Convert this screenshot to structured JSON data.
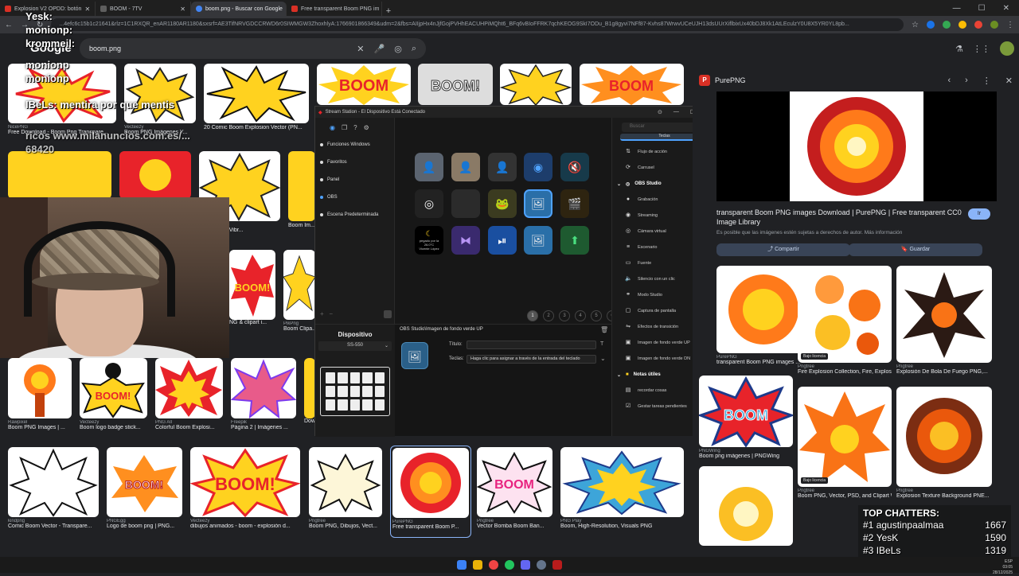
{
  "tabs": [
    {
      "label": "Explosion V2 OPDD: botón",
      "color": "#d93025",
      "active": false
    },
    {
      "label": "BOOM - 7TV",
      "color": "#5e5e5e",
      "active": false
    },
    {
      "label": "boom.png - Buscar con Google",
      "color": "#4285f4",
      "active": true
    },
    {
      "label": "Free transparent Boom PNG im",
      "color": "#d93025",
      "active": false
    }
  ],
  "url": "...4efc6c15b1c21641&rlz=1C1RXQR_enAR1180AR1180&sxsrf=AE3TifNRVGDCCRWD6r0SIWMGW3ZhoxhlyA:1766901866349&udm=2&fbs=AIIjpHx4nJjfGojPVHhEACUHPiMQht6_BFq6vBIoFFRK7qchKEOG9SkI7ODu_B1g8gyvi7NFf87-Kvhs87WrwvUCeUJH13dsUUrXiflbixUx40bDJ8Xk1AtLEculzY0U8X5YR0YL8pb...",
  "google": {
    "logo": "Google",
    "query": "boom.png"
  },
  "chat_overlay": [
    "Yesk:",
    "monionp:",
    "krommeil:",
    "monionp",
    "monionp",
    "IBeLs: mentira por que mentis",
    "ricos www.milanuncios.com.es/...",
    "68420"
  ],
  "grid_row1": [
    {
      "src": "NicePNG",
      "title": "Free Download - Boom Png Transpare..."
    },
    {
      "src": "Vecteezy",
      "title": "Boom PNG Imágenes Y..."
    },
    {
      "src": "",
      "title": "20 Comic Boom Explosion Vector (PN..."
    },
    {
      "src": "",
      "title": ""
    }
  ],
  "grid_row2": [
    {
      "src": "PNG All",
      "title": "c Explosion Vibr..."
    },
    {
      "src": "",
      "title": "Boom Im..."
    }
  ],
  "grid_row3": [
    {
      "src": "",
      "title": "NG & clipart i..."
    },
    {
      "src": "PikPng",
      "title": "Boom Clipa..."
    }
  ],
  "grid_row4": [
    {
      "src": "Rawpixel",
      "title": "Boom PNG Images | ..."
    },
    {
      "src": "Vecteezy",
      "title": "Boom logo badge stick..."
    },
    {
      "src": "PNG All",
      "title": "Colorful Boom Explosi..."
    },
    {
      "src": "Freepik",
      "title": "Página 2 | Imágenes ..."
    },
    {
      "src": "",
      "title": "Dow..."
    }
  ],
  "grid_row5": [
    {
      "src": "kindpng",
      "title": "Comic Boom Vector - Transpare..."
    },
    {
      "src": "PNGEgg",
      "title": "Logo de boom png | PNG..."
    },
    {
      "src": "Vecteezy",
      "title": "dibujos animados - boom - explosión d..."
    },
    {
      "src": "Pngtree",
      "title": "Boom PNG, Dibujos, Vect..."
    },
    {
      "src": "PurePNG",
      "title": "Free transparent Boom P..."
    },
    {
      "src": "Pngtree",
      "title": "Vector Bomba Boom Ban..."
    },
    {
      "src": "PNG Play",
      "title": "Boom, High-Resolution, Visuals PNG"
    }
  ],
  "boom_words": {
    "b1": "BOOM",
    "b2": "BOOM!",
    "b3": "BOOM",
    "b4": "BOOM!",
    "b5": "BOOM!",
    "b6": "BOOM"
  },
  "ss": {
    "title": "Stream Station - El Dispositivo Está Conectado",
    "profiles": [
      "Funciones Windows",
      "Favoritos",
      "Panel",
      "OBS",
      "Escena Predeterminada"
    ],
    "pages": [
      "1",
      "2",
      "3",
      "4",
      "5",
      "6",
      "+"
    ],
    "search_placeholder": "Buscar",
    "tab": "Teclas",
    "group_obs": "OBS Studio",
    "group_notes": "Notas útiles",
    "actions_top": [
      "Flujo de acción",
      "Carrusel"
    ],
    "actions_obs": [
      "Grabación",
      "Streaming",
      "Cámara virtual",
      "Escenario",
      "Fuente",
      "Silencio con un clic",
      "Modo Studio",
      "Captura de pantalla",
      "Efectos de transición",
      "Imagen de fondo verde UP",
      "Imagen de fondo verde DN"
    ],
    "actions_notes": [
      "recordar cosas",
      "Gestar tareas pendientes"
    ],
    "weather_label": "pegado por la",
    "weather_temp": "26.0°C",
    "weather_place": "Vicente López",
    "device_label": "Dispositivo",
    "device_model": "SS-550",
    "cfg_title": "OBS Studio\\Imagen de fondo verde UP",
    "label_titulo": "Título:",
    "label_teclas": "Teclas:",
    "teclas_hint": "Haga clic para asignar a través de la entrada del teclado"
  },
  "panel": {
    "source": "PurePNG",
    "title": "transparent Boom PNG images Download | PurePNG | Free transparent CC0 Image Library",
    "visit": "Ir",
    "note": "Es posible que las imágenes estén sujetas a derechos de autor. Más información",
    "share": "Compartir",
    "save": "Guardar",
    "related": [
      {
        "src": "PurePNG",
        "title": "transparent Boom PNG images ...",
        "badge": ""
      },
      {
        "src": "Pngtree",
        "title": "Fire Explosion Collection, Fire, Explosio...",
        "badge": "Bajo licencia"
      },
      {
        "src": "Pngtree",
        "title": "Explosión De Bola De Fuego PNG,...",
        "badge": ""
      },
      {
        "src": "PNGWing",
        "title": "Boom png imágenes | PNGWing",
        "badge": ""
      },
      {
        "src": "Pngtree",
        "title": "Boom PNG, Vector, PSD, and Clipart Wit...",
        "badge": "Bajo licencia"
      },
      {
        "src": "Pngtree",
        "title": "Explosion Texture Background PNE...",
        "badge": ""
      }
    ]
  },
  "top_chatters": {
    "title": "TOP CHATTERS:",
    "rows": [
      {
        "rank": "#1",
        "name": "agustinpaalmaa",
        "score": "1667"
      },
      {
        "rank": "#2",
        "name": "YesK",
        "score": "1590"
      },
      {
        "rank": "#3",
        "name": "IBeLs",
        "score": "1319"
      }
    ]
  },
  "clock": {
    "lang": "ESP",
    "time": "03:05",
    "date": "28/12/2025"
  },
  "colors": {
    "accent": "#8ab4f8",
    "ss_accent": "#4fa3ff",
    "boom_red": "#e8232a",
    "boom_yellow": "#ffd21f"
  }
}
